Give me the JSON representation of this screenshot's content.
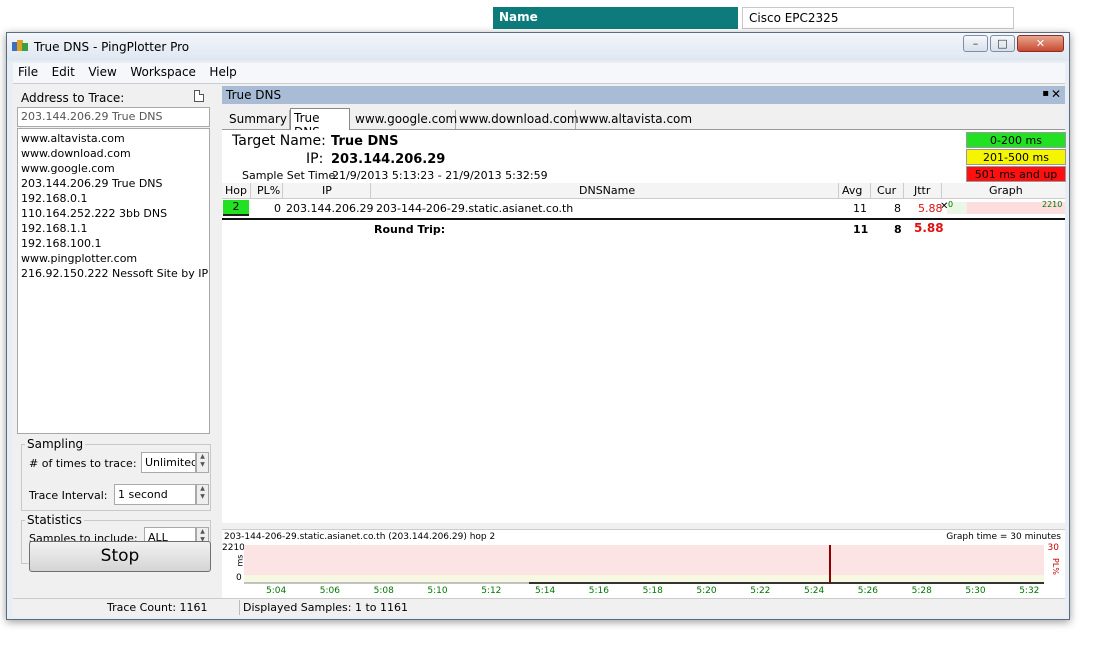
{
  "background": {
    "name_label": "Name",
    "name_value": "Cisco EPC2325"
  },
  "window": {
    "title": "True DNS - PingPlotter Pro",
    "minimize": "–",
    "restore": "□",
    "close": "✕"
  },
  "menu": [
    "File",
    "Edit",
    "View",
    "Workspace",
    "Help"
  ],
  "left": {
    "address_label": "Address to Trace:",
    "address_value": "203.144.206.29 True DNS",
    "history": [
      "www.altavista.com",
      "www.download.com",
      "www.google.com",
      "203.144.206.29 True DNS",
      "192.168.0.1",
      "110.164.252.222 3bb DNS",
      "192.168.1.1",
      "192.168.100.1",
      "www.pingplotter.com",
      "216.92.150.222 Nessoft Site by IP"
    ],
    "sampling_title": "Sampling",
    "times_label": "# of times to trace:",
    "times_value": "Unlimited",
    "interval_label": "Trace Interval:",
    "interval_value": "1 second",
    "statistics_title": "Statistics",
    "samples_label": "Samples to include:",
    "samples_value": "ALL",
    "stop_label": "Stop"
  },
  "panel": {
    "title": "True DNS",
    "pin": "▪",
    "close": "✕",
    "tabs": [
      "Summary",
      "True DNS",
      "www.google.com",
      "www.download.com",
      "www.altavista.com"
    ],
    "active_tab": "True DNS",
    "target_name_label": "Target Name:",
    "target_name_value": "True DNS",
    "ip_label": "IP:",
    "ip_value": "203.144.206.29",
    "sample_set_label": "Sample Set Time:",
    "sample_set_value": "21/9/2013 5:13:23 - 21/9/2013 5:32:59",
    "legend": [
      {
        "label": "0-200 ms",
        "color": "#22e022"
      },
      {
        "label": "201-500 ms",
        "color": "#f5f500"
      },
      {
        "label": "501 ms and up",
        "color": "#ff1010"
      }
    ],
    "columns": [
      "Hop",
      "PL%",
      "IP",
      "DNSName",
      "Avg",
      "Cur",
      "Jttr",
      "Graph"
    ],
    "rows": [
      {
        "hop": "2",
        "pl": "0",
        "ip": "203.144.206.29",
        "dns": "203-144-206-29.static.asianet.co.th",
        "avg": "11",
        "cur": "8",
        "jttr": "5.88",
        "graph_min": "0",
        "graph_max": "2210"
      }
    ],
    "round_trip": {
      "label": "Round Trip:",
      "avg": "11",
      "cur": "8",
      "jttr": "5.88"
    }
  },
  "bottom_graph": {
    "title": "203-144-206-29.static.asianet.co.th (203.144.206.29) hop 2",
    "graph_time": "Graph time = 30 minutes",
    "y_max": "2210",
    "y_min": "0",
    "y_unit": "ms",
    "pl_max": "30",
    "pl_unit": "PL%",
    "x_ticks": [
      "5:04",
      "5:06",
      "5:08",
      "5:10",
      "5:12",
      "5:14",
      "5:16",
      "5:18",
      "5:20",
      "5:22",
      "5:24",
      "5:26",
      "5:28",
      "5:30",
      "5:32"
    ]
  },
  "status": {
    "trace_count": "Trace Count: 1161",
    "displayed": "Displayed Samples: 1 to 1161"
  }
}
